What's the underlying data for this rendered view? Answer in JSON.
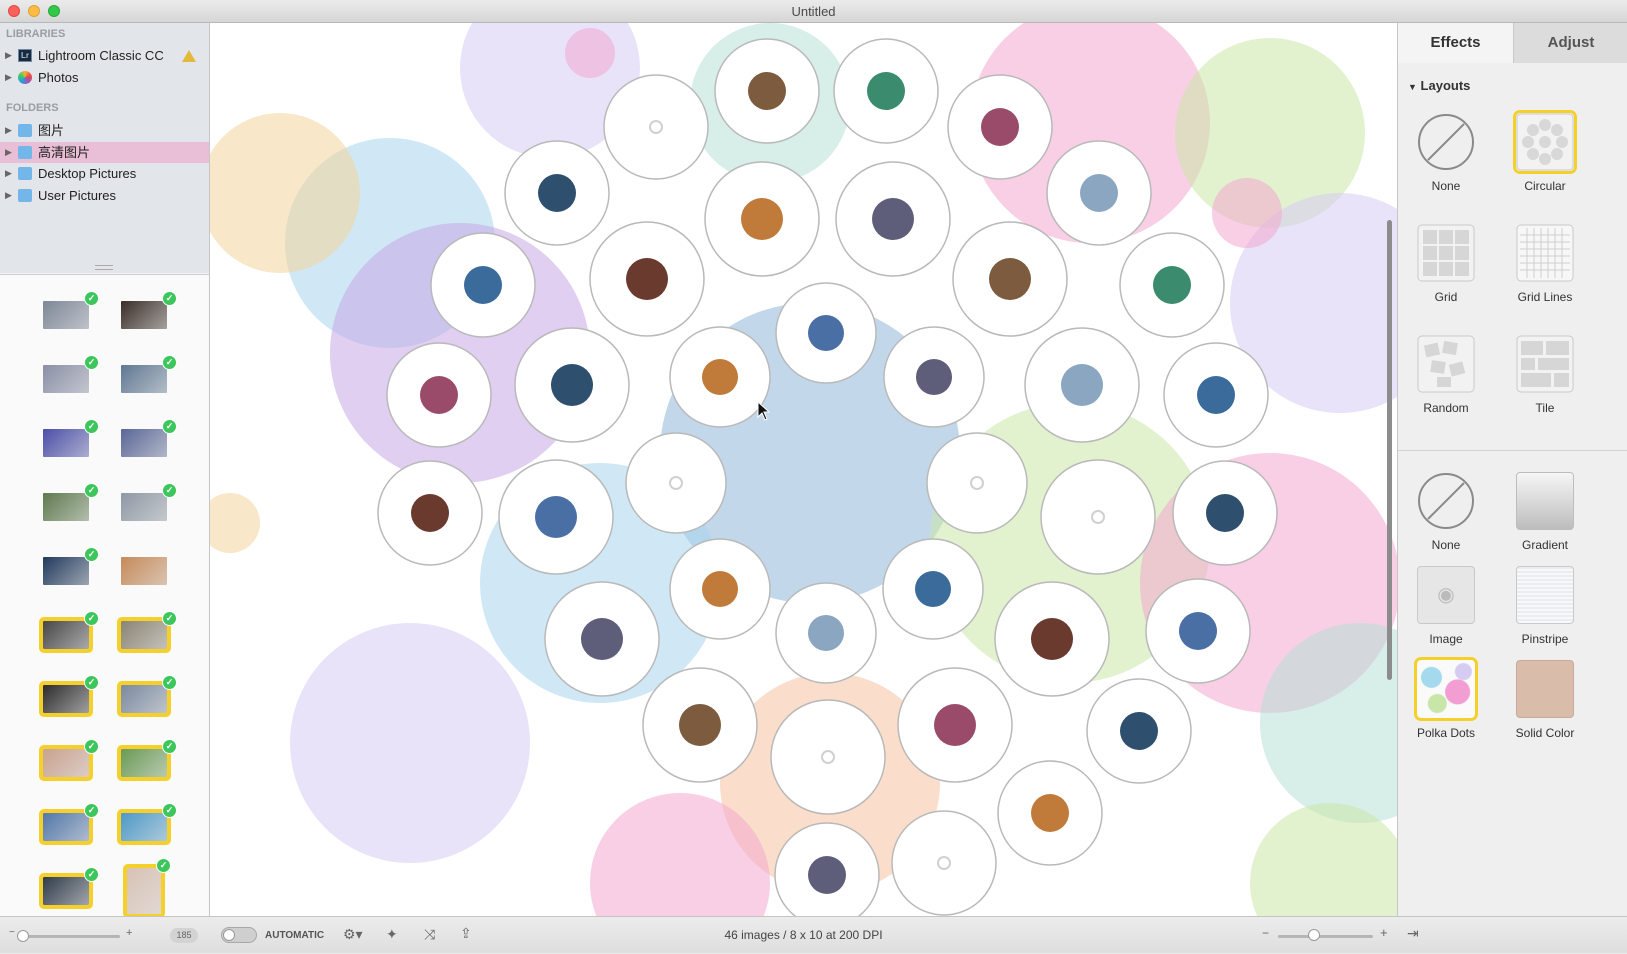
{
  "window": {
    "title": "Untitled"
  },
  "sidebar": {
    "libraries_header": "LIBRARIES",
    "libraries": [
      {
        "label": "Lightroom Classic CC",
        "icon": "lightroom-icon",
        "warning": true
      },
      {
        "label": "Photos",
        "icon": "photos-icon"
      }
    ],
    "folders_header": "FOLDERS",
    "folders": [
      {
        "label": "图片",
        "selected": false
      },
      {
        "label": "高清图片",
        "selected": true
      },
      {
        "label": "Desktop Pictures",
        "selected": false
      },
      {
        "label": "User Pictures",
        "selected": false
      }
    ],
    "thumbnail_count": "185",
    "thumbnails": [
      {
        "color": "#7d8797",
        "used": false,
        "checked": true
      },
      {
        "color": "#3a2e28",
        "used": false,
        "checked": true
      },
      {
        "color": "#8a8fa6",
        "used": false,
        "checked": true
      },
      {
        "color": "#5f7893",
        "used": false,
        "checked": true
      },
      {
        "color": "#4b4fa8",
        "used": false,
        "checked": true
      },
      {
        "color": "#5a6797",
        "used": false,
        "checked": true
      },
      {
        "color": "#5f7a4f",
        "used": false,
        "checked": true
      },
      {
        "color": "#8e98a4",
        "used": false,
        "checked": true
      },
      {
        "color": "#213a5c",
        "used": false,
        "checked": true
      },
      {
        "color": "#c58a59",
        "used": false,
        "checked": false
      },
      {
        "color": "#474747",
        "used": true,
        "checked": true
      },
      {
        "color": "#8b8473",
        "used": true,
        "checked": true
      },
      {
        "color": "#2c2c2c",
        "used": true,
        "checked": true
      },
      {
        "color": "#7a8aa0",
        "used": true,
        "checked": true
      },
      {
        "color": "#c9a28f",
        "used": true,
        "checked": true
      },
      {
        "color": "#6a9a55",
        "used": true,
        "checked": true
      },
      {
        "color": "#5277a8",
        "used": true,
        "checked": true
      },
      {
        "color": "#4d99c7",
        "used": true,
        "checked": true
      },
      {
        "color": "#2f3b4a",
        "used": true,
        "checked": true
      },
      {
        "color": "#d8c2b4",
        "used": true,
        "checked": true,
        "portrait": true
      }
    ]
  },
  "inspector": {
    "tabs": {
      "effects": "Effects",
      "adjust": "Adjust"
    },
    "layouts_header": "Layouts",
    "layouts": [
      {
        "label": "None",
        "kind": "none",
        "selected": false
      },
      {
        "label": "Circular",
        "kind": "circular",
        "selected": true
      },
      {
        "label": "Grid",
        "kind": "grid",
        "selected": false
      },
      {
        "label": "Grid Lines",
        "kind": "gridlines",
        "selected": false
      },
      {
        "label": "Random",
        "kind": "random",
        "selected": false
      },
      {
        "label": "Tile",
        "kind": "tile",
        "selected": false
      }
    ],
    "backgrounds": [
      {
        "label": "None",
        "kind": "none",
        "selected": false
      },
      {
        "label": "Gradient",
        "kind": "gradient",
        "selected": false
      },
      {
        "label": "Image",
        "kind": "image",
        "selected": false
      },
      {
        "label": "Pinstripe",
        "kind": "pinstripe",
        "selected": false
      },
      {
        "label": "Polka Dots",
        "kind": "polka",
        "selected": true
      },
      {
        "label": "Solid Color",
        "kind": "solid",
        "selected": false
      }
    ]
  },
  "bottombar": {
    "auto_label": "AUTOMATIC",
    "status": "46 images / 8 x 10 at 200 DPI"
  },
  "colors": {
    "accent_selection": "#f5d02b",
    "checkmark": "#3cc65b",
    "folder_selected": "#e8bfd6"
  }
}
